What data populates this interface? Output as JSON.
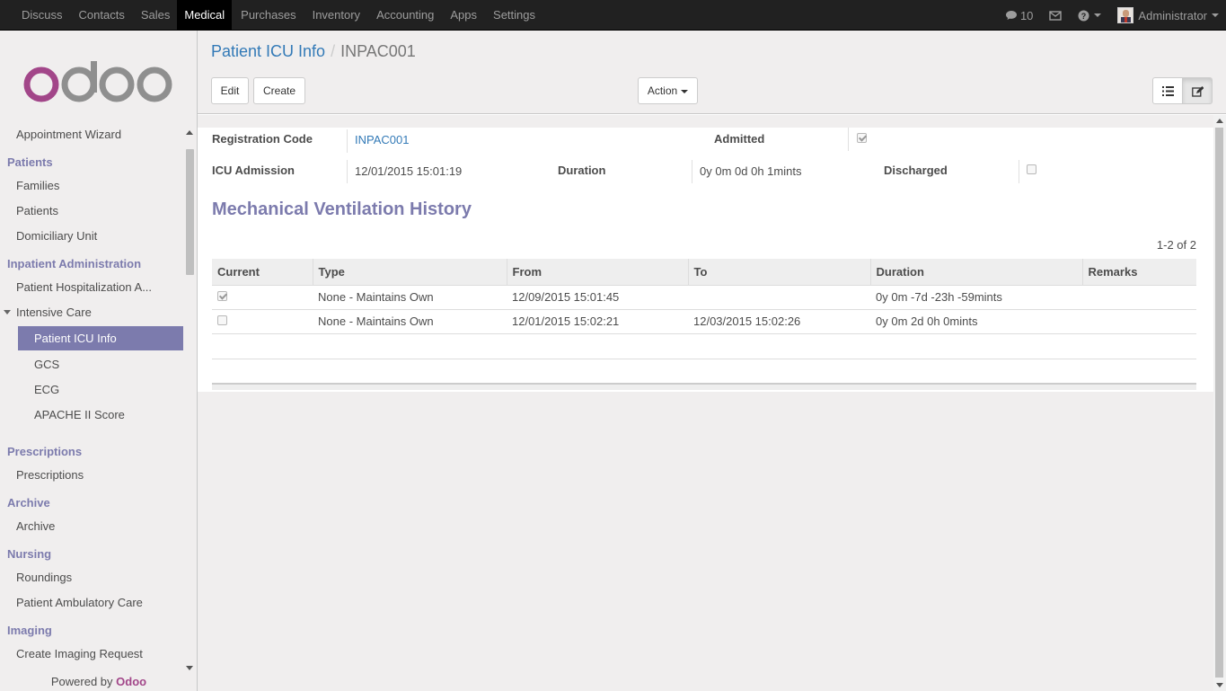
{
  "topbar": {
    "menu": [
      "Discuss",
      "Contacts",
      "Sales",
      "Medical",
      "Purchases",
      "Inventory",
      "Accounting",
      "Apps",
      "Settings"
    ],
    "active_menu": "Medical",
    "messages_count": "10",
    "user_name": "Administrator"
  },
  "sidebar": {
    "logo_text": "odoo",
    "items": {
      "appointment_wizard": "Appointment Wizard",
      "patients_heading": "Patients",
      "families": "Families",
      "patients": "Patients",
      "domiciliary_unit": "Domiciliary Unit",
      "inpatient_heading": "Inpatient Administration",
      "patient_hospitalization": "Patient Hospitalization A...",
      "intensive_care": "Intensive Care",
      "patient_icu_info": "Patient ICU Info",
      "gcs": "GCS",
      "ecg": "ECG",
      "apache": "APACHE II Score",
      "prescriptions_heading": "Prescriptions",
      "prescriptions": "Prescriptions",
      "archive_heading": "Archive",
      "archive": "Archive",
      "nursing_heading": "Nursing",
      "roundings": "Roundings",
      "ambulatory_care": "Patient Ambulatory Care",
      "imaging_heading": "Imaging",
      "imaging_request": "Create Imaging Request"
    },
    "powered_by": "Powered by",
    "powered_brand": "Odoo"
  },
  "control_panel": {
    "breadcrumb_parent": "Patient ICU Info",
    "breadcrumb_separator": "/",
    "breadcrumb_current": "INPAC001",
    "edit_label": "Edit",
    "create_label": "Create",
    "action_label": "Action"
  },
  "form": {
    "registration_code_label": "Registration Code",
    "registration_code_value": "INPAC001",
    "admitted_label": "Admitted",
    "admitted_checked": true,
    "icu_admission_label": "ICU Admission",
    "icu_admission_value": "12/01/2015 15:01:19",
    "duration_label": "Duration",
    "duration_value": "0y 0m 0d 0h 1mints",
    "discharged_label": "Discharged",
    "discharged_checked": false
  },
  "ventilation": {
    "title": "Mechanical Ventilation History",
    "pager": "1-2 of 2",
    "columns": [
      "Current",
      "Type",
      "From",
      "To",
      "Duration",
      "Remarks"
    ],
    "rows": [
      {
        "current": true,
        "type": "None - Maintains Own",
        "from": "12/09/2015 15:01:45",
        "to": "",
        "duration": "0y 0m -7d -23h -59mints",
        "remarks": ""
      },
      {
        "current": false,
        "type": "None - Maintains Own",
        "from": "12/01/2015 15:02:21",
        "to": "12/03/2015 15:02:26",
        "duration": "0y 0m 2d 0h 0mints",
        "remarks": ""
      }
    ]
  },
  "colors": {
    "brand_purple": "#7c7bad",
    "topbar": "#212121",
    "link_blue": "#337ab7",
    "odoo_magenta": "#a24689",
    "odoo_grey": "#8f8f8f"
  }
}
